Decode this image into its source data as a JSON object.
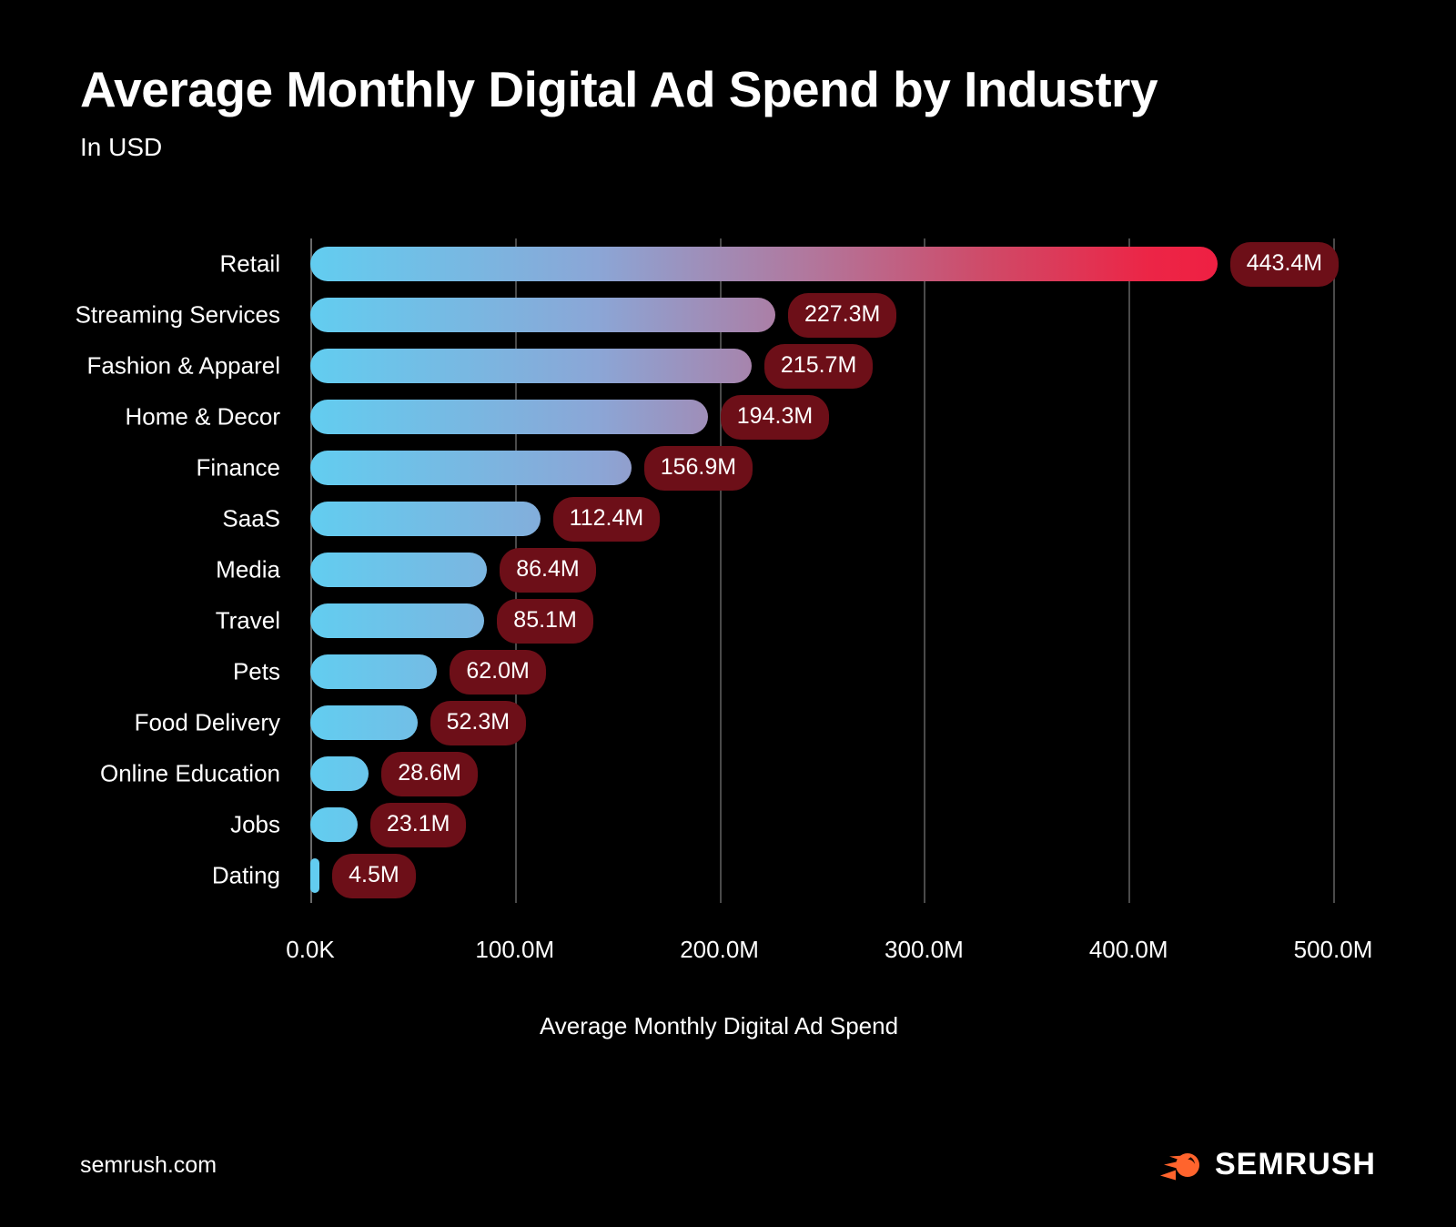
{
  "header": {
    "title": "Average Monthly Digital Ad Spend by Industry",
    "subtitle": "In USD"
  },
  "footer": {
    "url": "semrush.com",
    "brand_name": "SEMRUSH",
    "brand_mark_icon": "semrush-comet-icon"
  },
  "colors": {
    "background": "#000000",
    "bar_gradient_start": "#62cdf0",
    "bar_gradient_end": "#f4173d",
    "badge_background": "#6d0f18",
    "badge_text": "#ffffff",
    "gridline": "#4a4a4a",
    "brand_orange": "#ff642d",
    "text": "#ffffff"
  },
  "chart_data": {
    "type": "bar",
    "orientation": "horizontal",
    "title": "Average Monthly Digital Ad Spend by Industry",
    "subtitle": "In USD",
    "xlabel": "Average Monthly Digital Ad Spend",
    "ylabel": "",
    "xlim": [
      0,
      500000000
    ],
    "xticks": [
      0,
      100000000,
      200000000,
      300000000,
      400000000,
      500000000
    ],
    "xtick_labels": [
      "0.0K",
      "100.0M",
      "200.0M",
      "300.0M",
      "400.0M",
      "500.0M"
    ],
    "grid": true,
    "grid_axis": "x",
    "legend": false,
    "categories": [
      "Retail",
      "Streaming Services",
      "Fashion & Apparel",
      "Home & Decor",
      "Finance",
      "SaaS",
      "Media",
      "Travel",
      "Pets",
      "Food Delivery",
      "Online Education",
      "Jobs",
      "Dating"
    ],
    "values": [
      443400000,
      227300000,
      215700000,
      194300000,
      156900000,
      112400000,
      86400000,
      85100000,
      62000000,
      52300000,
      28600000,
      23100000,
      4500000
    ],
    "value_labels": [
      "443.4M",
      "227.3M",
      "215.7M",
      "194.3M",
      "156.9M",
      "112.4M",
      "86.4M",
      "85.1M",
      "62.0M",
      "52.3M",
      "28.6M",
      "23.1M",
      "4.5M"
    ]
  }
}
